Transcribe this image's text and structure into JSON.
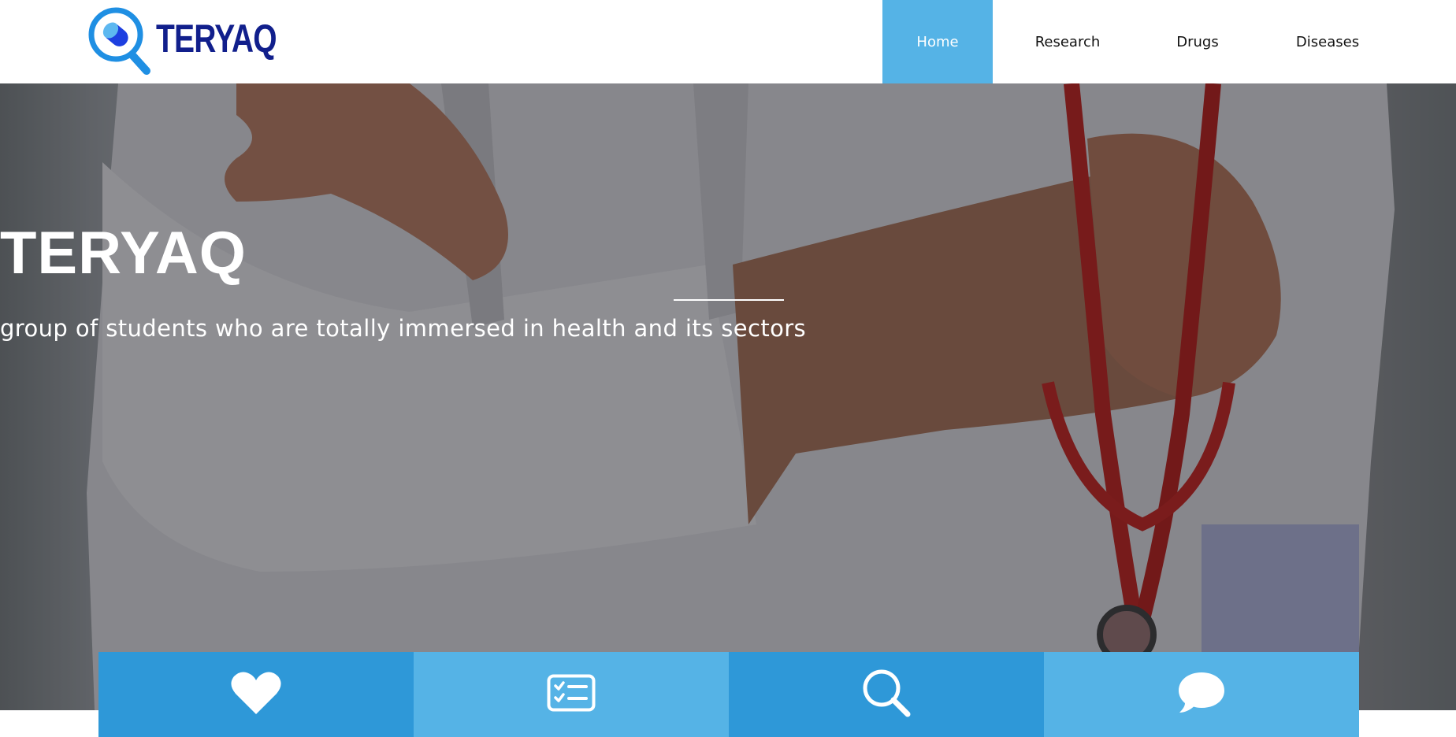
{
  "header": {
    "logo": {
      "text": "TERYAQ",
      "icon": "magnifier-pill-icon"
    },
    "nav": [
      {
        "label": "Home",
        "active": true
      },
      {
        "label": "Research",
        "active": false
      },
      {
        "label": "Drugs",
        "active": false
      },
      {
        "label": "Diseases",
        "active": false
      }
    ]
  },
  "hero": {
    "title": "TERYAQ",
    "subtitle": "group of students who are totally immersed in health and its sectors"
  },
  "tiles": [
    {
      "icon": "heart-icon"
    },
    {
      "icon": "checklist-icon"
    },
    {
      "icon": "search-icon"
    },
    {
      "icon": "chat-bubble-icon"
    }
  ],
  "colors": {
    "accent_light": "#55b3e6",
    "accent_dark": "#2e98d8",
    "logo_text": "#111f8c"
  }
}
